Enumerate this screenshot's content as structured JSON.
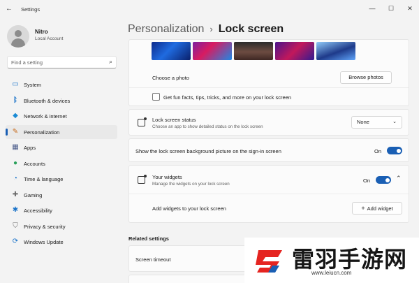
{
  "window": {
    "title": "Settings",
    "controls": [
      "—",
      "☐",
      "✕"
    ]
  },
  "profile": {
    "name": "Nitro",
    "account": "Local Account"
  },
  "search": {
    "placeholder": "Find a setting"
  },
  "nav": {
    "items": [
      {
        "label": "System",
        "icon": "monitor-icon",
        "glyph": "🖥",
        "color": "#1a73c9",
        "active": false
      },
      {
        "label": "Bluetooth & devices",
        "icon": "bluetooth-icon",
        "glyph": "ᛒ",
        "color": "#1a73c9",
        "active": false
      },
      {
        "label": "Network & internet",
        "icon": "wifi-icon",
        "glyph": "◆",
        "color": "#1a8ad4",
        "active": false
      },
      {
        "label": "Personalization",
        "icon": "brush-icon",
        "glyph": "✎",
        "color": "#c86a1a",
        "active": true
      },
      {
        "label": "Apps",
        "icon": "apps-icon",
        "glyph": "▦",
        "color": "#4a5b8a",
        "active": false
      },
      {
        "label": "Accounts",
        "icon": "person-icon",
        "glyph": "●",
        "color": "#2aa05a",
        "active": false
      },
      {
        "label": "Time & language",
        "icon": "globe-clock-icon",
        "glyph": "◔",
        "color": "#1a73c9",
        "active": false
      },
      {
        "label": "Gaming",
        "icon": "gamepad-icon",
        "glyph": "✚",
        "color": "#6b6b6b",
        "active": false
      },
      {
        "label": "Accessibility",
        "icon": "accessibility-icon",
        "glyph": "✱",
        "color": "#1a73c9",
        "active": false
      },
      {
        "label": "Privacy & security",
        "icon": "shield-icon",
        "glyph": "⛉",
        "color": "#6b6b6b",
        "active": false
      },
      {
        "label": "Windows Update",
        "icon": "update-icon",
        "glyph": "⟳",
        "color": "#1a73c9",
        "active": false
      }
    ]
  },
  "breadcrumb": {
    "parent": "Personalization",
    "separator": "›",
    "current": "Lock screen"
  },
  "background_card": {
    "choose_photo_label": "Choose a photo",
    "browse_button": "Browse photos",
    "fun_facts_label": "Get fun facts, tips, tricks, and more on your lock screen",
    "fun_facts_checked": false
  },
  "status_card": {
    "title": "Lock screen status",
    "description": "Choose an app to show detailed status on the lock screen",
    "selected": "None"
  },
  "signin_card": {
    "label": "Show the lock screen background picture on the sign-in screen",
    "state": "On"
  },
  "widgets_card": {
    "title": "Your widgets",
    "description": "Manage the widgets on your lock screen",
    "state": "On",
    "add_label": "Add widgets to your lock screen",
    "add_button": "Add widget"
  },
  "related": {
    "title": "Related settings",
    "screen_timeout": "Screen timeout"
  },
  "watermark": {
    "text": "雷羽手游网",
    "url": "www.leiucn.com"
  },
  "colors": {
    "accent": "#1a5fb4",
    "window_bg": "#f3f3f3",
    "card_bg": "#fbfbfb",
    "watermark_red": "#e52420"
  }
}
